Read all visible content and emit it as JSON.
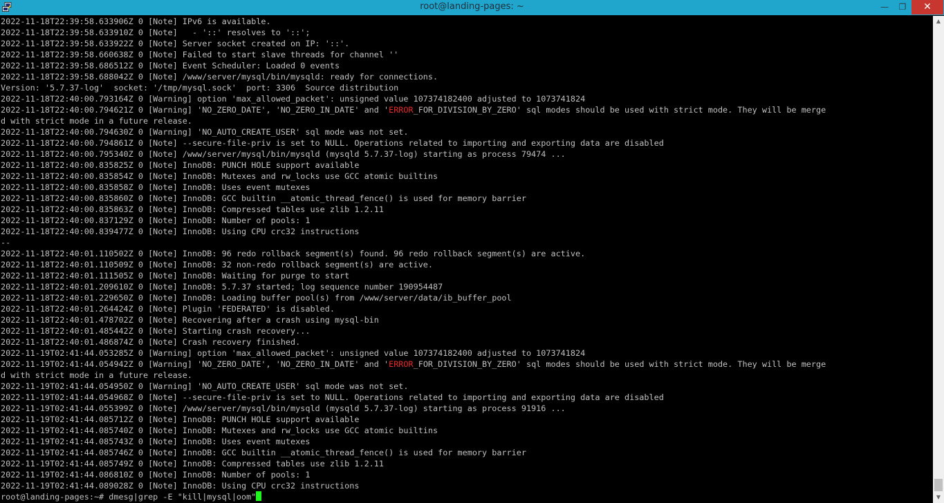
{
  "window": {
    "title": "root@landing-pages: ~",
    "icon": "putty-icon",
    "controls": {
      "minimize": "—",
      "maximize": "❐",
      "close": "✕"
    },
    "accent": "#20a5cd",
    "close_color": "#c7372f"
  },
  "terminal": {
    "text_color": "#c0c0c0",
    "highlight_color": "#e52b2b",
    "cursor_color": "#1ef51e",
    "lines": [
      [
        "2022-11-18T22:39:58.633906Z 0 [Note] IPv6 is available."
      ],
      [
        "2022-11-18T22:39:58.633910Z 0 [Note]   - '::' resolves to '::';"
      ],
      [
        "2022-11-18T22:39:58.633922Z 0 [Note] Server socket created on IP: '::'."
      ],
      [
        "2022-11-18T22:39:58.660638Z 0 [Note] Failed to start slave threads for channel ''"
      ],
      [
        "2022-11-18T22:39:58.686512Z 0 [Note] Event Scheduler: Loaded 0 events"
      ],
      [
        "2022-11-18T22:39:58.688042Z 0 [Note] /www/server/mysql/bin/mysqld: ready for connections."
      ],
      [
        "Version: '5.7.37-log'  socket: '/tmp/mysql.sock'  port: 3306  Source distribution"
      ],
      [
        "2022-11-18T22:40:00.793164Z 0 [Warning] option 'max_allowed_packet': unsigned value 107374182400 adjusted to 1073741824"
      ],
      [
        "2022-11-18T22:40:00.794621Z 0 [Warning] 'NO_ZERO_DATE', 'NO_ZERO_IN_DATE' and '",
        "ERROR",
        "_FOR_DIVISION_BY_ZERO' sql modes should be used with strict mode. They will be merge"
      ],
      [
        "d with strict mode in a future release."
      ],
      [
        "2022-11-18T22:40:00.794630Z 0 [Warning] 'NO_AUTO_CREATE_USER' sql mode was not set."
      ],
      [
        "2022-11-18T22:40:00.794861Z 0 [Note] --secure-file-priv is set to NULL. Operations related to importing and exporting data are disabled"
      ],
      [
        "2022-11-18T22:40:00.795340Z 0 [Note] /www/server/mysql/bin/mysqld (mysqld 5.7.37-log) starting as process 79474 ..."
      ],
      [
        "2022-11-18T22:40:00.835825Z 0 [Note] InnoDB: PUNCH HOLE support available"
      ],
      [
        "2022-11-18T22:40:00.835854Z 0 [Note] InnoDB: Mutexes and rw_locks use GCC atomic builtins"
      ],
      [
        "2022-11-18T22:40:00.835858Z 0 [Note] InnoDB: Uses event mutexes"
      ],
      [
        "2022-11-18T22:40:00.835860Z 0 [Note] InnoDB: GCC builtin __atomic_thread_fence() is used for memory barrier"
      ],
      [
        "2022-11-18T22:40:00.835863Z 0 [Note] InnoDB: Compressed tables use zlib 1.2.11"
      ],
      [
        "2022-11-18T22:40:00.837129Z 0 [Note] InnoDB: Number of pools: 1"
      ],
      [
        "2022-11-18T22:40:00.839477Z 0 [Note] InnoDB: Using CPU crc32 instructions"
      ],
      [
        "--"
      ],
      [
        "2022-11-18T22:40:01.110502Z 0 [Note] InnoDB: 96 redo rollback segment(s) found. 96 redo rollback segment(s) are active."
      ],
      [
        "2022-11-18T22:40:01.110509Z 0 [Note] InnoDB: 32 non-redo rollback segment(s) are active."
      ],
      [
        "2022-11-18T22:40:01.111505Z 0 [Note] InnoDB: Waiting for purge to start"
      ],
      [
        "2022-11-18T22:40:01.209610Z 0 [Note] InnoDB: 5.7.37 started; log sequence number 190954487"
      ],
      [
        "2022-11-18T22:40:01.229650Z 0 [Note] InnoDB: Loading buffer pool(s) from /www/server/data/ib_buffer_pool"
      ],
      [
        "2022-11-18T22:40:01.264424Z 0 [Note] Plugin 'FEDERATED' is disabled."
      ],
      [
        "2022-11-18T22:40:01.478702Z 0 [Note] Recovering after a crash using mysql-bin"
      ],
      [
        "2022-11-18T22:40:01.485442Z 0 [Note] Starting crash recovery..."
      ],
      [
        "2022-11-18T22:40:01.486874Z 0 [Note] Crash recovery finished."
      ],
      [
        "2022-11-19T02:41:44.053285Z 0 [Warning] option 'max_allowed_packet': unsigned value 107374182400 adjusted to 1073741824"
      ],
      [
        "2022-11-19T02:41:44.054942Z 0 [Warning] 'NO_ZERO_DATE', 'NO_ZERO_IN_DATE' and '",
        "ERROR",
        "_FOR_DIVISION_BY_ZERO' sql modes should be used with strict mode. They will be merge"
      ],
      [
        "d with strict mode in a future release."
      ],
      [
        "2022-11-19T02:41:44.054950Z 0 [Warning] 'NO_AUTO_CREATE_USER' sql mode was not set."
      ],
      [
        "2022-11-19T02:41:44.054968Z 0 [Note] --secure-file-priv is set to NULL. Operations related to importing and exporting data are disabled"
      ],
      [
        "2022-11-19T02:41:44.055399Z 0 [Note] /www/server/mysql/bin/mysqld (mysqld 5.7.37-log) starting as process 91916 ..."
      ],
      [
        "2022-11-19T02:41:44.085712Z 0 [Note] InnoDB: PUNCH HOLE support available"
      ],
      [
        "2022-11-19T02:41:44.085740Z 0 [Note] InnoDB: Mutexes and rw_locks use GCC atomic builtins"
      ],
      [
        "2022-11-19T02:41:44.085743Z 0 [Note] InnoDB: Uses event mutexes"
      ],
      [
        "2022-11-19T02:41:44.085746Z 0 [Note] InnoDB: GCC builtin __atomic_thread_fence() is used for memory barrier"
      ],
      [
        "2022-11-19T02:41:44.085749Z 0 [Note] InnoDB: Compressed tables use zlib 1.2.11"
      ],
      [
        "2022-11-19T02:41:44.086810Z 0 [Note] InnoDB: Number of pools: 1"
      ],
      [
        "2022-11-19T02:41:44.089028Z 0 [Note] InnoDB: Using CPU crc32 instructions"
      ]
    ],
    "prompt": "root@landing-pages:~# ",
    "command": "dmesg|grep -E \"kill|mysql|oom\""
  },
  "scrollbar": {
    "up_icon": "▲",
    "down_icon": "▼"
  }
}
